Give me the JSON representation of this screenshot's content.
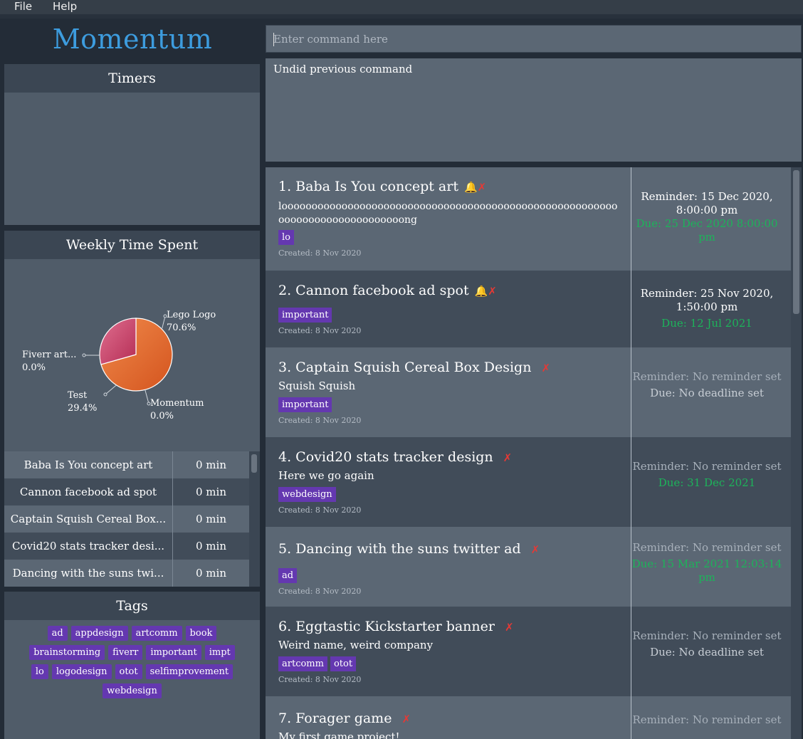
{
  "menu": {
    "file": "File",
    "help": "Help"
  },
  "app": {
    "title": "Momentum"
  },
  "timers": {
    "header": "Timers"
  },
  "weekly": {
    "header": "Weekly Time Spent",
    "pie": [
      {
        "name": "Lego Logo",
        "percent": "70.6%",
        "value": 70.6,
        "color": "#e35c24"
      },
      {
        "name": "Test",
        "percent": "29.4%",
        "value": 29.4,
        "color": "#c23a5e"
      },
      {
        "name": "Momentum",
        "percent": "0.0%",
        "value": 0.0,
        "color": "#3a6fb0"
      },
      {
        "name": "Fiverr art...",
        "percent": "0.0%",
        "value": 0.0,
        "color": "#2e9e6a"
      }
    ],
    "rows": [
      {
        "name": "Baba Is You concept art",
        "time": "0 min"
      },
      {
        "name": "Cannon facebook ad spot",
        "time": "0 min"
      },
      {
        "name": "Captain Squish Cereal Box...",
        "time": "0 min"
      },
      {
        "name": "Covid20 stats tracker desi...",
        "time": "0 min"
      },
      {
        "name": "Dancing with the suns twi...",
        "time": "0 min"
      }
    ]
  },
  "tags": {
    "header": "Tags",
    "items": [
      "ad",
      "appdesign",
      "artcomm",
      "book",
      "brainstorming",
      "fiverr",
      "important",
      "impt",
      "lo",
      "logodesign",
      "otot",
      "selfimprovement",
      "webdesign"
    ]
  },
  "command": {
    "placeholder": "Enter command here",
    "result": "Undid previous command"
  },
  "projects": [
    {
      "title": "1. Baba Is You concept art",
      "bell": true,
      "desc": "looooooooooooooooooooooooooooooooooooooooooooooooooooooooooooooooooooooooooooong",
      "tags": [
        "lo"
      ],
      "created": "Created: 8 Nov 2020",
      "reminder": "Reminder: 15 Dec 2020, 8:00:00 pm",
      "reminder_set": true,
      "due": "Due: 25 Dec 2020 8:00:00 pm",
      "due_set": true
    },
    {
      "title": "2. Cannon facebook ad spot",
      "bell": true,
      "desc": "",
      "tags": [
        "important"
      ],
      "created": "Created: 8 Nov 2020",
      "reminder": "Reminder: 25 Nov 2020, 1:50:00 pm",
      "reminder_set": true,
      "due": "Due: 12 Jul 2021",
      "due_set": true
    },
    {
      "title": "3. Captain Squish Cereal Box Design",
      "bell": false,
      "desc": "Squish Squish",
      "tags": [
        "important"
      ],
      "created": "Created: 8 Nov 2020",
      "reminder": "Reminder: No reminder set",
      "reminder_set": false,
      "due": "Due: No deadline set",
      "due_set": false
    },
    {
      "title": "4. Covid20 stats tracker design",
      "bell": false,
      "desc": "Here we go again",
      "tags": [
        "webdesign"
      ],
      "created": "Created: 8 Nov 2020",
      "reminder": "Reminder: No reminder set",
      "reminder_set": false,
      "due": "Due: 31 Dec 2021",
      "due_set": true
    },
    {
      "title": "5. Dancing with the suns twitter ad",
      "bell": false,
      "desc": "",
      "tags": [
        "ad"
      ],
      "created": "Created: 8 Nov 2020",
      "reminder": "Reminder: No reminder set",
      "reminder_set": false,
      "due": "Due: 15 Mar 2021 12:03:14 pm",
      "due_set": true
    },
    {
      "title": "6. Eggtastic Kickstarter banner",
      "bell": false,
      "desc": "Weird name, weird company",
      "tags": [
        "artcomm",
        "otot"
      ],
      "created": "Created: 8 Nov 2020",
      "reminder": "Reminder: No reminder set",
      "reminder_set": false,
      "due": "Due: No deadline set",
      "due_set": false
    },
    {
      "title": "7. Forager game",
      "bell": false,
      "desc": "My first game project!",
      "tags": [],
      "created": "",
      "reminder": "Reminder: No reminder set",
      "reminder_set": false,
      "due": "",
      "due_set": false
    }
  ]
}
